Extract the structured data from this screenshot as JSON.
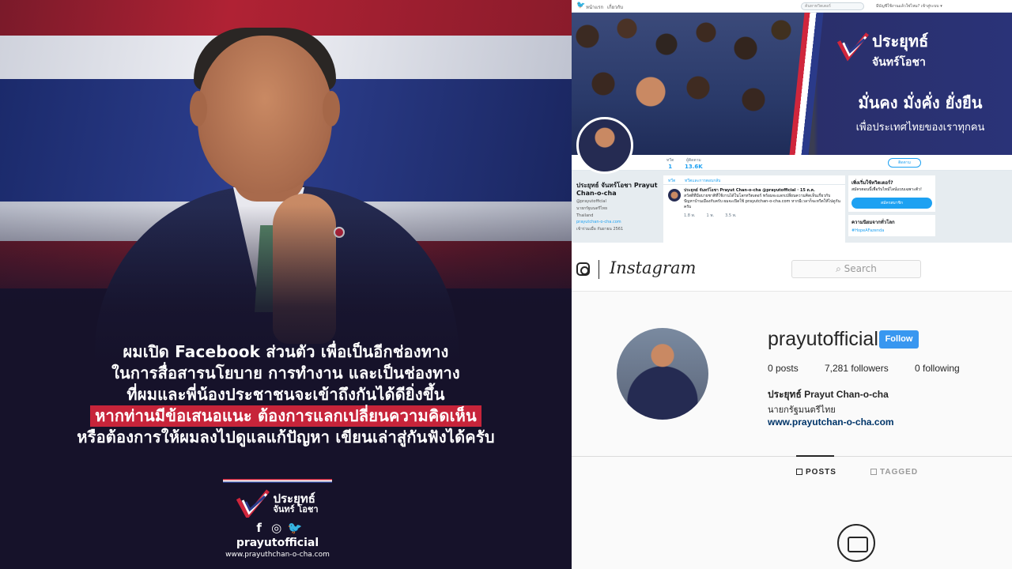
{
  "poster": {
    "lines": [
      "ผมเปิด Facebook ส่วนตัว เพื่อเป็นอีกช่องทาง",
      "ในการสื่อสารนโยบาย การทำงาน และเป็นช่องทาง",
      "ที่ผมและพี่น้องประชาชนจะเข้าถึงกันได้ดียิ่งขึ้น",
      "หากท่านมีข้อเสนอแนะ ต้องการแลกเปลี่ยนความคิดเห็น",
      "หรือต้องการให้ผมลงไปดูแลแก้ปัญหา เขียนเล่าสู่กันฟังได้ครับ"
    ],
    "logo_name": "ประยุทธ์",
    "logo_surname": "จันทร์ โอชา",
    "social_icons": [
      "facebook-icon",
      "instagram-icon",
      "twitter-icon"
    ],
    "social_glyphs": {
      "fb": "f",
      "ig": "◎",
      "tw": "🐦"
    },
    "handle": "prayutofficial",
    "url": "www.prayuthchan-o-cha.com",
    "colors": {
      "highlight": "#c7243a",
      "background": "#16122a"
    }
  },
  "twitter": {
    "nav_home": "หน้าแรก",
    "nav_about": "เกี่ยวกับ",
    "search_placeholder": "ค้นหาทวิตเตอร์",
    "login_text": "มีบัญชีใช้งานแล้วใช่ไหม? เข้าสู่ระบบ ▾",
    "banner_name": "ประยุทธ์",
    "banner_surname": "จันทร์โอชา",
    "banner_slogan": "มั่นคง มั่งคั่ง ยั่งยืน",
    "banner_sub": "เพื่อประเทศไทยของเราทุกคน",
    "stats": [
      {
        "label": "ทวีต",
        "value": "1"
      },
      {
        "label": "ผู้ติดตาม",
        "value": "13.6K"
      }
    ],
    "follow_label": "ติดตาม",
    "profile_name": "ประยุทธ์ จันทร์โอชา Prayut Chan-o-cha",
    "profile_handle": "@prayutofficial",
    "profile_title": "นายกรัฐมนตรีไทย",
    "profile_location": "Thailand",
    "profile_link": "prayutchan-o-cha.com",
    "profile_joined": "เข้าร่วมเมื่อ กันยายน 2561",
    "feed_tabs": [
      "ทวีต",
      "ทวีตและการตอบกลับ"
    ],
    "tweet_author": "ประยุทธ์ จันทร์โอชา Prayut Chan-o-cha @prayutofficial · 15 ต.ค.",
    "tweet_text": "สวัสดีที่มีอบายชาติที่ใช้งานได้ในโลกทวิตเตอร์ พร้อมจะแลกเปลี่ยนความคิดเห็นเกี่ยวกับปัญหาบ้านเมืองกับครับ ผมจะเปิดใช้ prayutchan-o-cha.com หากมีเวลาก็จะทวีตให้ไปดูกันครับ",
    "tweet_actions": [
      "1.8 พ.",
      "1 พ.",
      "3.5 พ."
    ],
    "side_title": "เพิ่งเริ่มใช้ทวิตเตอร์?",
    "side_text": "สมัครตอนนี้เพื่อรับไทม์ไลน์แบบเฉพาะตัว!",
    "side_signup": "สมัครสมาชิก",
    "side_trends": "ความนิยมจากทั่วโลก",
    "side_tag": "#HopeAFazenda"
  },
  "instagram": {
    "logo": "Instagram",
    "search_placeholder": "⌕ Search",
    "username": "prayutofficial",
    "follow_label": "Follow",
    "posts": "0 posts",
    "followers": "7,281 followers",
    "following": "0 following",
    "fullname": "ประยุทธ์ Prayut Chan-o-cha",
    "bio": "นายกรัฐมนตรีไทย",
    "website": "www.prayutchan-o-cha.com",
    "tab_posts": "POSTS",
    "tab_tagged": "TAGGED",
    "colors": {
      "follow": "#3897f0",
      "link": "#003569"
    }
  }
}
